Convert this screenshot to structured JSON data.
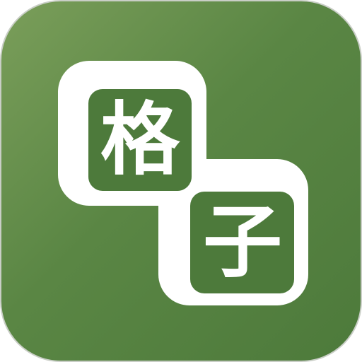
{
  "app_icon": {
    "tiles": [
      {
        "char": "格"
      },
      {
        "char": "子"
      }
    ],
    "colors": {
      "background": "#5a8644",
      "tile_fill": "#4d7a3b",
      "tile_outline": "#ffffff",
      "border": "#c9cec6"
    }
  }
}
